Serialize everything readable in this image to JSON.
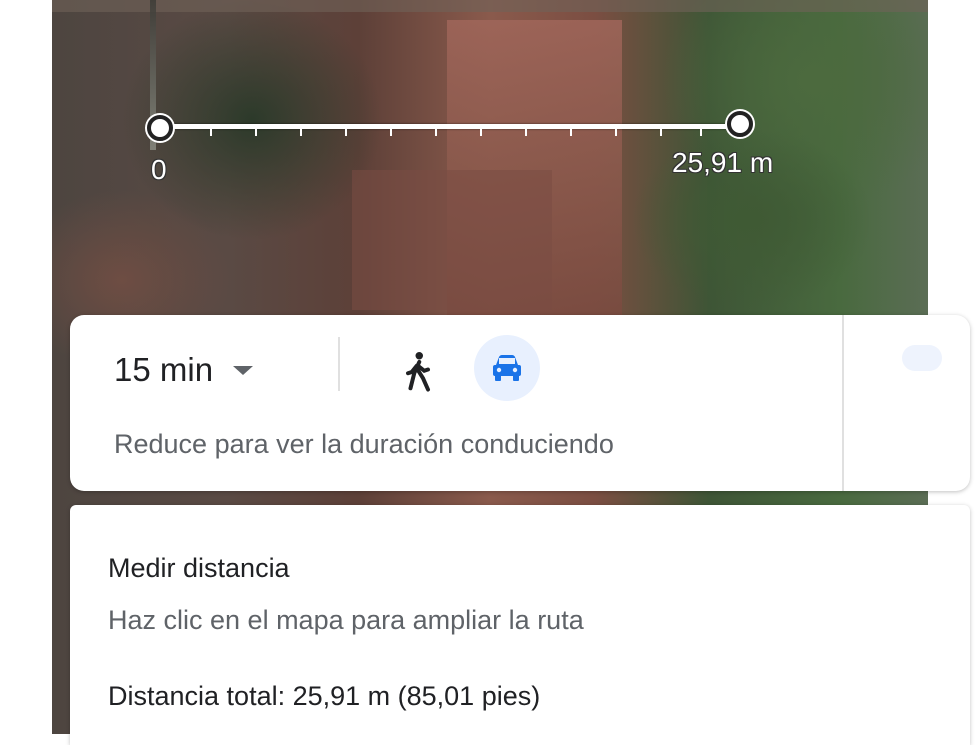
{
  "map": {
    "scale_start": "0",
    "scale_end": "25,91 m"
  },
  "directions": {
    "duration": "15 min",
    "mode_walk_icon": "walk-icon",
    "mode_drive_icon": "car-icon",
    "hint": "Reduce para ver la duración conduciendo",
    "accent_color": "#1a73e8"
  },
  "measure": {
    "title": "Medir distancia",
    "subtitle": "Haz clic en el mapa para ampliar la ruta",
    "total": "Distancia total: 25,91 m (85,01 pies)"
  }
}
